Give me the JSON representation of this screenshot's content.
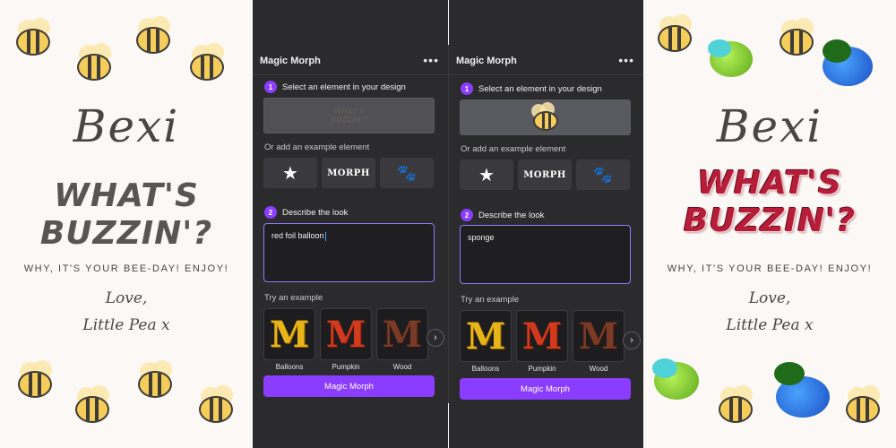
{
  "card_left": {
    "name": "Bexi",
    "headline": [
      "WHAT'S",
      "BUZZIN'?"
    ],
    "subtitle": "WHY, IT'S YOUR BEE-DAY! ENJOY!",
    "signature": [
      "Love,",
      "Little Pea x"
    ]
  },
  "card_right": {
    "name": "Bexi",
    "headline": [
      "WHAT'S",
      "BUZZIN'?"
    ],
    "subtitle": "WHY, IT'S YOUR BEE-DAY! ENJOY!",
    "signature": [
      "Love,",
      "Little Pea x"
    ]
  },
  "panel_left": {
    "title": "Magic Morph",
    "menu_icon": "•••",
    "step1_num": "1",
    "step1_label": "Select an element in your design",
    "preview_text": [
      "WHAT'S",
      "BUZZIN'?"
    ],
    "or_add_label": "Or add an example element",
    "examples": [
      "★",
      "MORPH",
      "🐾"
    ],
    "step2_num": "2",
    "step2_label": "Describe the look",
    "prompt_value": "red foil balloon",
    "try_label": "Try an example",
    "try_items": [
      {
        "glyph": "M",
        "label": "Balloons"
      },
      {
        "glyph": "M",
        "label": "Pumpkin"
      },
      {
        "glyph": "M",
        "label": "Wood"
      }
    ],
    "next_icon": "›",
    "cta_label": "Magic Morph"
  },
  "panel_right": {
    "title": "Magic Morph",
    "menu_icon": "•••",
    "step1_num": "1",
    "step1_label": "Select an element in your design",
    "or_add_label": "Or add an example element",
    "examples": [
      "★",
      "MORPH",
      "🐾"
    ],
    "step2_num": "2",
    "step2_label": "Describe the look",
    "prompt_value": "sponge",
    "try_label": "Try an example",
    "try_items": [
      {
        "glyph": "M",
        "label": "Balloons"
      },
      {
        "glyph": "M",
        "label": "Pumpkin"
      },
      {
        "glyph": "M",
        "label": "Wood"
      }
    ],
    "next_icon": "›",
    "cta_label": "Magic Morph"
  },
  "colors": {
    "accent": "#8b3dff",
    "panel_bg": "#2b2b2e",
    "card_bg": "#fbf8f5",
    "balloon_red": "#b51d38",
    "bee_yellow": "#f5cd5a"
  }
}
